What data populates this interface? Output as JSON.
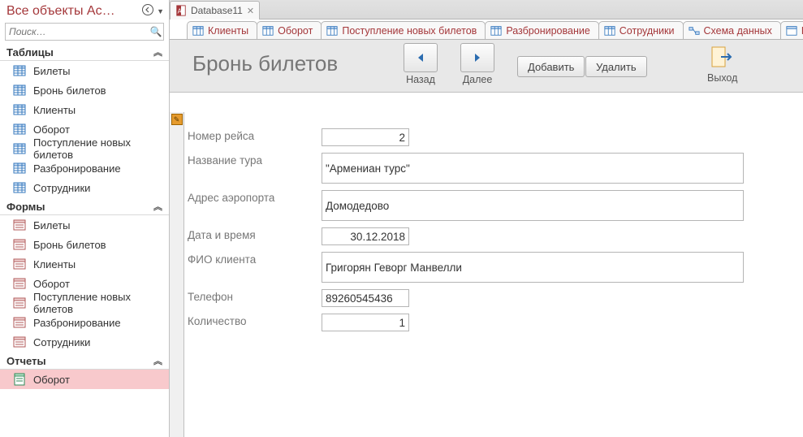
{
  "nav": {
    "title": "Все объекты Ac…",
    "search_placeholder": "Поиск…",
    "groups": [
      {
        "name": "Таблицы",
        "items": [
          "Билеты",
          "Бронь билетов",
          "Клиенты",
          "Оборот",
          "Поступление новых билетов",
          "Разбронирование",
          "Сотрудники"
        ],
        "icon": "table"
      },
      {
        "name": "Формы",
        "items": [
          "Билеты",
          "Бронь билетов",
          "Клиенты",
          "Оборот",
          "Поступление новых билетов",
          "Разбронирование",
          "Сотрудники"
        ],
        "icon": "form"
      },
      {
        "name": "Отчеты",
        "items": [
          "Оборот"
        ],
        "icon": "report",
        "selected": "Оборот"
      }
    ]
  },
  "doc_tab": {
    "label": "Database11"
  },
  "obj_tabs": [
    {
      "label": "Клиенты",
      "icon": "table"
    },
    {
      "label": "Оборот",
      "icon": "table"
    },
    {
      "label": "Поступление новых билетов",
      "icon": "table"
    },
    {
      "label": "Разбронирование",
      "icon": "table"
    },
    {
      "label": "Сотрудники",
      "icon": "table"
    },
    {
      "label": "Схема данных",
      "icon": "rel"
    },
    {
      "label": "Б",
      "icon": "table"
    }
  ],
  "header": {
    "form_title": "Бронь билетов",
    "back": "Назад",
    "next": "Далее",
    "add": "Добавить",
    "delete": "Удалить",
    "exit": "Выход"
  },
  "fields": {
    "flight_no": {
      "label": "Номер рейса",
      "value": "2"
    },
    "tour_name": {
      "label": "Название тура",
      "value": "\"Армениан турс\""
    },
    "airport": {
      "label": "Адрес аэропорта",
      "value": "Домодедово"
    },
    "datetime": {
      "label": "Дата и время",
      "value": "30.12.2018"
    },
    "client": {
      "label": "ФИО клиента",
      "value": "Григорян Геворг Манвелли"
    },
    "phone": {
      "label": "Телефон",
      "value": "89260545436"
    },
    "qty": {
      "label": "Количество",
      "value": "1"
    }
  }
}
